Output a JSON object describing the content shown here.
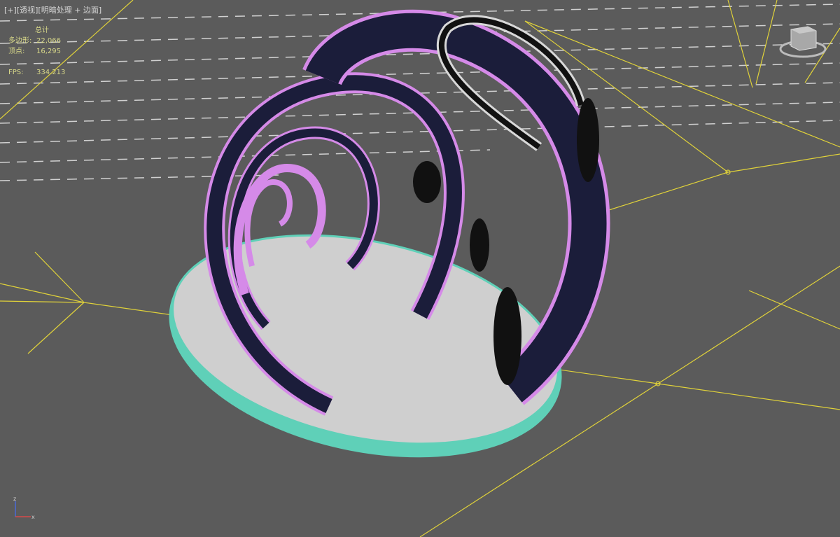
{
  "viewport": {
    "label_plus": "[+]",
    "label_view": "[透视]",
    "label_shading": "[明暗处理 + 边面]",
    "stats": {
      "title": "总计",
      "polygons_label": "多边形:",
      "polygons_value": "22,066",
      "vertices_label": "顶点:",
      "vertices_value": "16,295",
      "fps_label": "FPS:",
      "fps_value": "334.213"
    },
    "axis": {
      "x": "x",
      "z": "z"
    }
  },
  "colors": {
    "background": "#5b5b5b",
    "grid": "#e6e6e6",
    "light_lines": "#e0d23a",
    "stats_text": "#d9d98a",
    "base_top": "#cfcfcf",
    "base_rim": "#5fd0b8",
    "arch_edge": "#d58ae8",
    "arch_fill": "#1b1d3a"
  },
  "icons": [
    "viewcube-icon",
    "axis-gizmo-icon"
  ]
}
